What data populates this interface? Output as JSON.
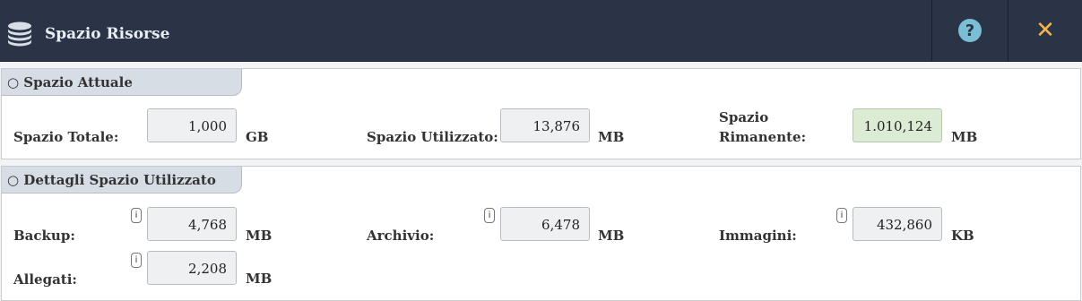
{
  "window": {
    "title": "Spazio Risorse",
    "icon": "database-icon",
    "help_symbol": "?",
    "close_symbol": "✕"
  },
  "current_space": {
    "heading": "○ Spazio Attuale",
    "total": {
      "label": "Spazio Totale:",
      "value": "1,000",
      "unit": "GB"
    },
    "used": {
      "label": "Spazio Utilizzato:",
      "value": "13,876",
      "unit": "MB"
    },
    "remaining": {
      "label_line1": "Spazio",
      "label_line2": "Rimanente:",
      "value": "1.010,124",
      "unit": "MB"
    }
  },
  "used_details": {
    "heading": "○ Dettagli Spazio Utilizzato",
    "info_symbol": "i",
    "backup": {
      "label": "Backup:",
      "value": "4,768",
      "unit": "MB"
    },
    "archive": {
      "label": "Archivio:",
      "value": "6,478",
      "unit": "MB"
    },
    "images": {
      "label": "Immagini:",
      "value": "432,860",
      "unit": "KB"
    },
    "attachments": {
      "label": "Allegati:",
      "value": "2,208",
      "unit": "MB"
    }
  },
  "colors": {
    "titlebar": "#2b3446",
    "help_accent": "#7bbfd6",
    "close_accent": "#f2b44b",
    "remaining_highlight": "#dcebd4"
  }
}
